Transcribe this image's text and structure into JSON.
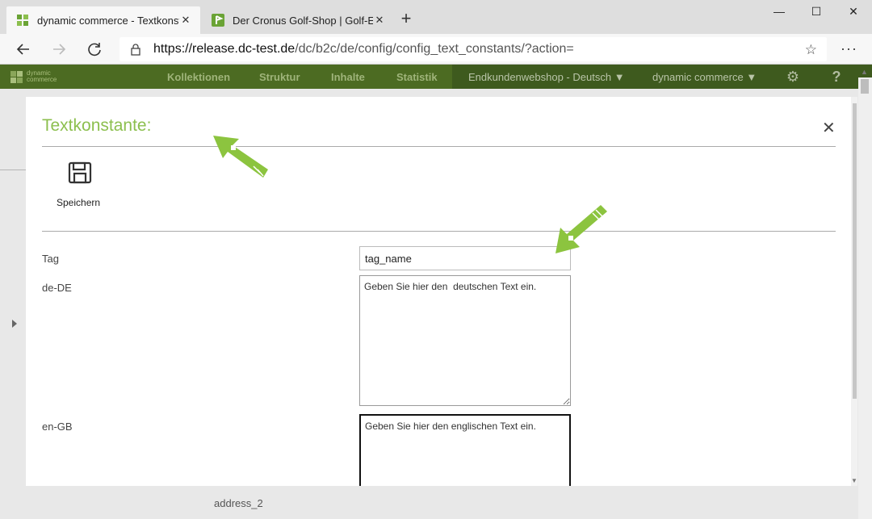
{
  "browser": {
    "tabs": [
      {
        "title": "dynamic commerce - Textkonsta",
        "active": true
      },
      {
        "title": "Der Cronus Golf-Shop | Golf-Equ",
        "active": false
      }
    ],
    "url_host": "https://release.dc-test.de",
    "url_path": "/dc/b2c/de/config/config_text_constants/?action=",
    "colors": {
      "tab_favicon": "#6aa335",
      "accent": "#8cbf4e"
    }
  },
  "app": {
    "logo_text_1": "dynamic",
    "logo_text_2": "commerce",
    "nav": [
      "Kollektionen",
      "Struktur",
      "Inhalte",
      "Statistik"
    ],
    "shop_select": "Endkundenwebshop - Deutsch",
    "company_select": "dynamic commerce",
    "help": "?",
    "background_text": "address_2"
  },
  "modal": {
    "title": "Textkonstante:",
    "save_label": "Speichern",
    "fields": {
      "tag_label": "Tag",
      "tag_value": "tag_name",
      "de_label": "de-DE",
      "de_value": "Geben Sie hier den  deutschen Text ein.",
      "en_label": "en-GB",
      "en_value": "Geben Sie hier den englischen Text ein."
    }
  }
}
